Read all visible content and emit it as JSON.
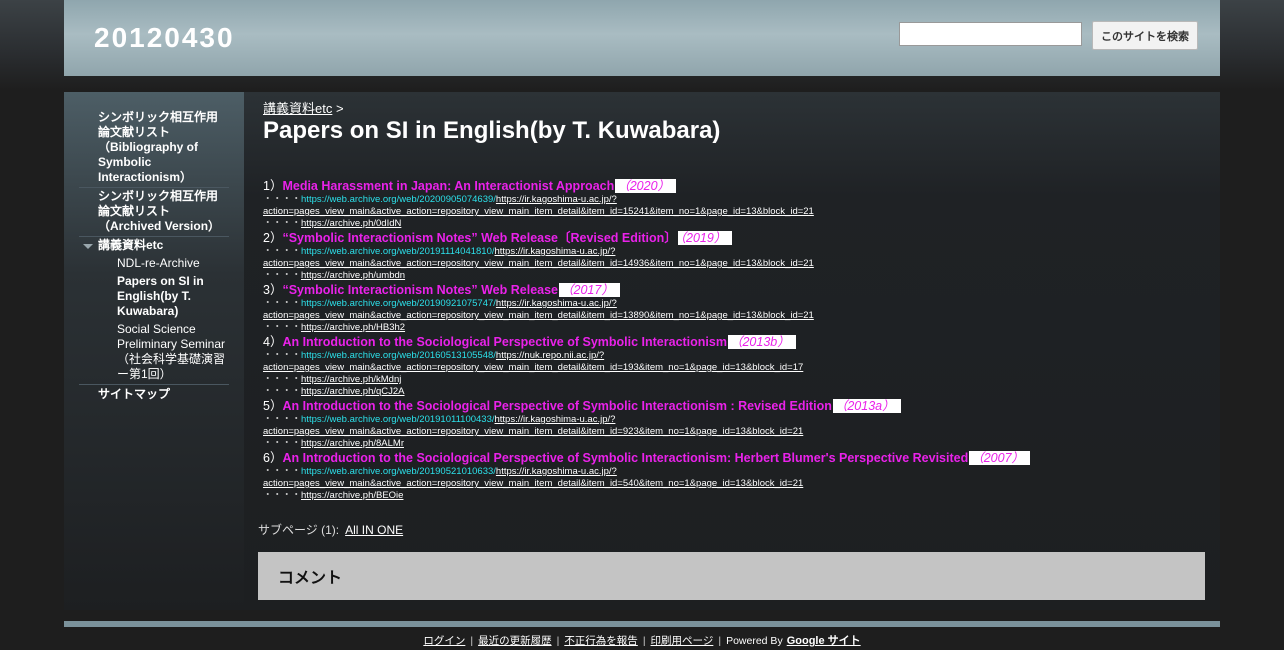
{
  "site": {
    "title": "20120430"
  },
  "search": {
    "placeholder": "",
    "button_label": "このサイトを検索"
  },
  "sidebar": {
    "items": [
      {
        "label": "シンボリック相互作用論文献リスト（Bibliography of Symbolic Interactionism）"
      },
      {
        "label": "シンボリック相互作用論文献リスト（Archived Version）"
      },
      {
        "label": "講義資料etc",
        "expanded": true,
        "children": [
          {
            "label": "NDL-re-Archive"
          },
          {
            "label": "Papers on SI in English(by T. Kuwabara)",
            "current": true
          },
          {
            "label": "Social Science Preliminary Seminar（社会科学基礎演習ー第1回）"
          }
        ]
      },
      {
        "label": "サイトマップ"
      }
    ]
  },
  "main": {
    "breadcrumb": {
      "link": "講義資料etc",
      "sep": ">"
    },
    "title": "Papers on SI in English(by T. Kuwabara)",
    "papers": [
      {
        "num": "1）",
        "title": "Media Harassment in Japan: An Interactionist Approach",
        "year": "（2020）",
        "links": [
          {
            "dots": "・・・・",
            "wayback": "https://web.archive.org/web/20200905074639/",
            "url": "https://ir.kagoshima-u.ac.jp/?"
          },
          {
            "dots": "",
            "wayback": "",
            "url": "action=pages_view_main&active_action=repository_view_main_item_detail&item_id=15241&item_no=1&page_id=13&block_id=21"
          },
          {
            "dots": "・・・・",
            "wayback": "",
            "url": "https://archive.ph/0dIdN"
          }
        ]
      },
      {
        "num": "2）",
        "title": "“Symbolic Interactionism Notes” Web Release〔Revised Edition〕",
        "year": "（2019）",
        "links": [
          {
            "dots": "・・・・",
            "wayback": "https://web.archive.org/web/20191114041810/",
            "url": "https://ir.kagoshima-u.ac.jp/?"
          },
          {
            "dots": "",
            "wayback": "",
            "url": "action=pages_view_main&active_action=repository_view_main_item_detail&item_id=14936&item_no=1&page_id=13&block_id=21"
          },
          {
            "dots": "・・・・",
            "wayback": "",
            "url": "https://archive.ph/umbdn"
          }
        ]
      },
      {
        "num": "3）",
        "title": "“Symbolic Interactionism Notes” Web Release",
        "year": "（2017）",
        "links": [
          {
            "dots": "・・・・",
            "wayback": "https://web.archive.org/web/20190921075747/",
            "url": "https://ir.kagoshima-u.ac.jp/?"
          },
          {
            "dots": "",
            "wayback": "",
            "url": "action=pages_view_main&active_action=repository_view_main_item_detail&item_id=13890&item_no=1&page_id=13&block_id=21"
          },
          {
            "dots": "・・・・",
            "wayback": "",
            "url": "https://archive.ph/HB3h2"
          }
        ]
      },
      {
        "num": "4）",
        "title": "An Introduction to the Sociological Perspective of Symbolic Interactionism",
        "year": "（2013b）",
        "links": [
          {
            "dots": "・・・・",
            "wayback": "https://web.archive.org/web/20160513105548/",
            "url": "https://nuk.repo.nii.ac.jp/?"
          },
          {
            "dots": "",
            "wayback": "",
            "url": "action=pages_view_main&active_action=repository_view_main_item_detail&item_id=193&item_no=1&page_id=13&block_id=17"
          },
          {
            "dots": "・・・・",
            "wayback": "",
            "url": "https://archive.ph/kMdnj"
          },
          {
            "dots": "・・・・",
            "wayback": "",
            "url": "https://archive.ph/qCJ2A"
          }
        ]
      },
      {
        "num": "5）",
        "title": "An Introduction to the Sociological Perspective of Symbolic Interactionism : Revised Edition",
        "year": "（2013a）",
        "links": [
          {
            "dots": "・・・・",
            "wayback": "https://web.archive.org/web/20191011100433/",
            "url": "https://ir.kagoshima-u.ac.jp/?"
          },
          {
            "dots": "",
            "wayback": "",
            "url": "action=pages_view_main&active_action=repository_view_main_item_detail&item_id=923&item_no=1&page_id=13&block_id=21"
          },
          {
            "dots": "・・・・",
            "wayback": "",
            "url": "https://archive.ph/8ALMr"
          }
        ]
      },
      {
        "num": "6）",
        "title": "An Introduction to the Sociological Perspective of Symbolic Interactionism: Herbert Blumer's Perspective Revisited",
        "year": "（2007）",
        "links": [
          {
            "dots": "・・・・",
            "wayback": "https://web.archive.org/web/20190521010633/",
            "url": "https://ir.kagoshima-u.ac.jp/?"
          },
          {
            "dots": "",
            "wayback": "",
            "url": "action=pages_view_main&active_action=repository_view_main_item_detail&item_id=540&item_no=1&page_id=13&block_id=21"
          },
          {
            "dots": "・・・・",
            "wayback": "",
            "url": "https://archive.ph/BEOie"
          }
        ]
      }
    ],
    "subpages": {
      "label": "サブページ (1):",
      "link": "All IN ONE"
    },
    "comments": {
      "heading": "コメント"
    }
  },
  "footer": {
    "links": [
      "ログイン",
      "最近の更新履歴",
      "不正行為を報告",
      "印刷用ページ"
    ],
    "powered_by": "Powered By",
    "google_sites": "Google サイト"
  },
  "colors": {
    "title_magenta": "#ea22ea",
    "wayback_cyan": "#2ce0ea",
    "header_blue_gray": "#a9bcc2",
    "comment_panel": "#c4c4c4"
  }
}
